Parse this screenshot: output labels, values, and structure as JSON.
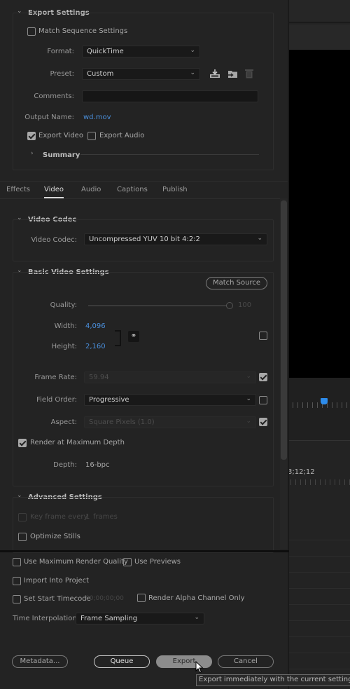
{
  "export_settings": {
    "title": "Export Settings",
    "match_sequence": {
      "label": "Match Sequence Settings",
      "checked": false
    },
    "format": {
      "label": "Format:",
      "value": "QuickTime"
    },
    "preset": {
      "label": "Preset:",
      "value": "Custom"
    },
    "preset_icons": [
      "save-preset-icon",
      "import-preset-icon",
      "delete-preset-icon"
    ],
    "comments": {
      "label": "Comments:",
      "value": ""
    },
    "output_name": {
      "label": "Output Name:",
      "value": "wd.mov"
    },
    "export_video": {
      "label": "Export Video",
      "checked": true
    },
    "export_audio": {
      "label": "Export Audio",
      "checked": false
    },
    "summary": {
      "label": "Summary"
    }
  },
  "tabs": [
    {
      "label": "Effects",
      "active": false
    },
    {
      "label": "Video",
      "active": true
    },
    {
      "label": "Audio",
      "active": false
    },
    {
      "label": "Captions",
      "active": false
    },
    {
      "label": "Publish",
      "active": false
    }
  ],
  "video_codec": {
    "title": "Video Codec",
    "label": "Video Codec:",
    "value": "Uncompressed YUV 10 bit 4:2:2"
  },
  "basic_video": {
    "title": "Basic Video Settings",
    "match_source": "Match Source",
    "quality": {
      "label": "Quality:",
      "value": "100"
    },
    "width": {
      "label": "Width:",
      "value": "4,096"
    },
    "height": {
      "label": "Height:",
      "value": "2,160"
    },
    "frame_rate": {
      "label": "Frame Rate:",
      "value": "59.94",
      "checked": true
    },
    "field_order": {
      "label": "Field Order:",
      "value": "Progressive",
      "checked": false
    },
    "aspect": {
      "label": "Aspect:",
      "value": "Square Pixels (1.0)",
      "checked": true
    },
    "render_max_depth": {
      "label": "Render at Maximum Depth",
      "checked": true
    },
    "depth": {
      "label": "Depth:",
      "value": "16-bpc"
    }
  },
  "advanced": {
    "title": "Advanced Settings",
    "keyframe": {
      "label": "Key frame every",
      "value": "1",
      "unit": "frames",
      "checked": false
    },
    "optimize_stills": {
      "label": "Optimize Stills",
      "checked": false
    }
  },
  "bottom": {
    "max_render_quality": {
      "label": "Use Maximum Render Quality",
      "checked": false
    },
    "use_previews": {
      "label": "Use Previews",
      "checked": false
    },
    "import_project": {
      "label": "Import Into Project",
      "checked": false
    },
    "start_timecode": {
      "label": "Set Start Timecode",
      "value": "00;00;00;00",
      "checked": false
    },
    "alpha_only": {
      "label": "Render Alpha Channel Only",
      "checked": false
    },
    "time_interp": {
      "label": "Time Interpolation:",
      "value": "Frame Sampling"
    }
  },
  "buttons": {
    "metadata": "Metadata...",
    "queue": "Queue",
    "export": "Export",
    "cancel": "Cancel"
  },
  "tooltip": "Export immediately with the current settings.",
  "timeline": {
    "timecode": "3;12;12"
  },
  "colors": {
    "accent_blue": "#4a8fdc",
    "playhead": "#2d8ceb"
  }
}
